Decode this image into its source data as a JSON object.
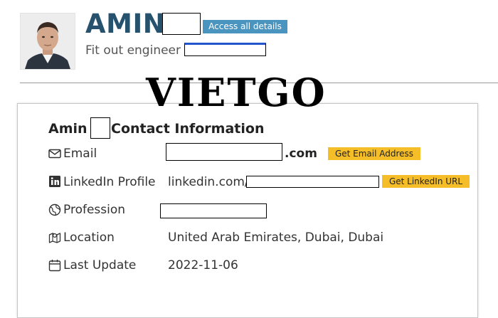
{
  "profile": {
    "name": "AMIN",
    "access_button": "Access all details",
    "subtitle": "Fit out engineer"
  },
  "watermark": "VIETGO",
  "card": {
    "title_first": "Amin",
    "title_rest": "Contact Information",
    "rows": [
      {
        "label": "Email",
        "icon": "envelope-icon",
        "value_suffix": ".com",
        "action": "Get Email Address"
      },
      {
        "label": "LinkedIn Profile",
        "icon": "linkedin-icon",
        "value_prefix": "linkedin.com/",
        "action": "Get LinkedIn URL"
      },
      {
        "label": "Profession",
        "icon": "globe-icon"
      },
      {
        "label": "Location",
        "icon": "map-icon",
        "value": "United Arab Emirates, Dubai, Dubai"
      },
      {
        "label": "Last Update",
        "icon": "calendar-icon",
        "value": "2022-11-06"
      }
    ]
  },
  "colors": {
    "name": "#26526e",
    "access_button": "#4a94c0",
    "action_button": "#f5bd27"
  }
}
